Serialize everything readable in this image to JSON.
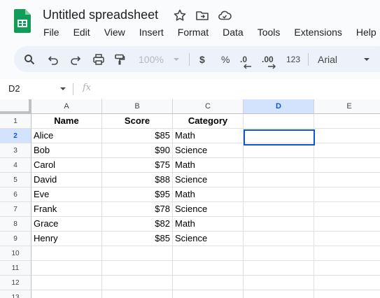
{
  "app": {
    "title": "Untitled spreadsheet"
  },
  "menu": [
    "File",
    "Edit",
    "View",
    "Insert",
    "Format",
    "Data",
    "Tools",
    "Extensions",
    "Help"
  ],
  "toolbar": {
    "zoom": "100%",
    "currency": "$",
    "percent": "%",
    "dec_less": ".0",
    "dec_more": ".00",
    "number_format": "123",
    "font": "Arial"
  },
  "formula_bar": {
    "cell_ref": "D2",
    "fx_label": "fx",
    "formula": ""
  },
  "colors": {
    "accent": "#0b57d0",
    "selected_header": "#d3e3fd",
    "logo_green": "#0f9d58"
  },
  "columns": [
    "A",
    "B",
    "C",
    "D",
    "E"
  ],
  "row_numbers": [
    "1",
    "2",
    "3",
    "4",
    "5",
    "6",
    "7",
    "8",
    "9",
    "10",
    "11",
    "12",
    "13"
  ],
  "selected": {
    "column": "D",
    "row": "2"
  },
  "table": {
    "headers": [
      "Name",
      "Score",
      "Category"
    ],
    "rows": [
      [
        "Alice",
        "$85",
        "Math"
      ],
      [
        "Bob",
        "$90",
        "Science"
      ],
      [
        "Carol",
        "$75",
        "Math"
      ],
      [
        "David",
        "$88",
        "Science"
      ],
      [
        "Eve",
        "$95",
        "Math"
      ],
      [
        "Frank",
        "$78",
        "Science"
      ],
      [
        "Grace",
        "$82",
        "Math"
      ],
      [
        "Henry",
        "$85",
        "Science"
      ]
    ]
  }
}
